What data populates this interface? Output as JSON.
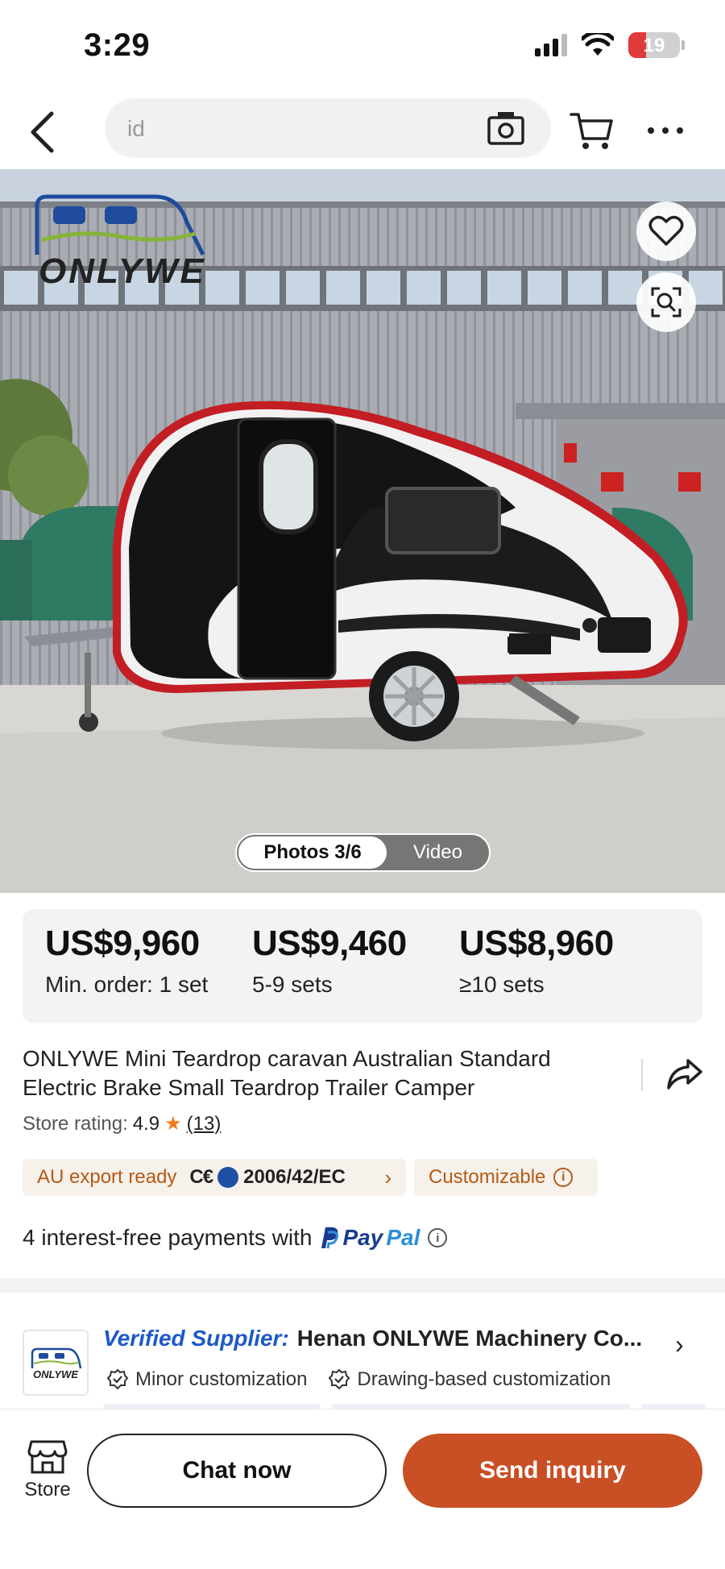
{
  "status_bar": {
    "time": "3:29",
    "battery": "19"
  },
  "nav": {
    "search_value": "id"
  },
  "hero": {
    "logo_text": "ONLYWE",
    "media_photos": "Photos 3/6",
    "media_video": "Video"
  },
  "price_tiers": [
    {
      "price": "US$9,960",
      "qty": "Min. order: 1 set"
    },
    {
      "price": "US$9,460",
      "qty": "5-9 sets"
    },
    {
      "price": "US$8,960",
      "qty": "≥10 sets"
    }
  ],
  "product": {
    "title": "ONLYWE Mini Teardrop caravan Australian Standard Electric Brake Small Teardrop Trailer Camper",
    "rating_label": "Store rating:",
    "rating_value": "4.9",
    "rating_count": "(13)"
  },
  "chips": {
    "export_label": "AU export ready",
    "ce_mark": "C€",
    "directive": "2006/42/EC",
    "customizable": "Customizable"
  },
  "payment": {
    "text": "4 interest-free payments with",
    "paypal_pay": "Pay",
    "paypal_pal": "Pal"
  },
  "supplier": {
    "verified_label": "Verified Supplier:",
    "name": "Henan ONLYWE Machinery Co...",
    "logo_text": "ONLYWE",
    "customizations": [
      "Minor customization",
      "Drawing-based customization"
    ]
  },
  "bottom_bar": {
    "store_label": "Store",
    "chat_label": "Chat now",
    "inquiry_label": "Send inquiry"
  },
  "colors": {
    "accent": "#c94f24",
    "chip_text": "#b35a17",
    "verified": "#1e59c8"
  }
}
